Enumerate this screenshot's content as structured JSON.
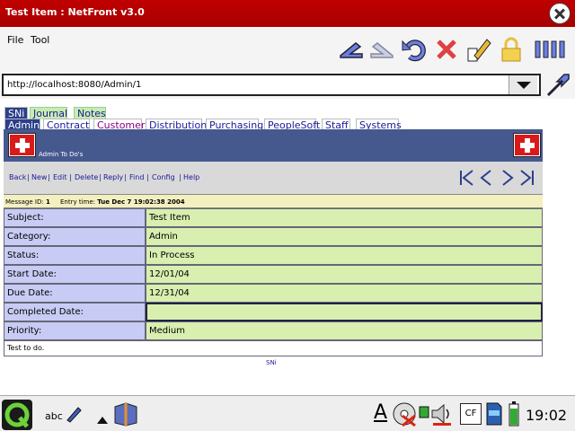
{
  "window": {
    "title": "Test Item : NetFront v3.0"
  },
  "menu": {
    "file": "File",
    "tool": "Tool"
  },
  "toolbar": [
    "back-icon",
    "forward-icon",
    "reload-icon",
    "stop-icon",
    "edit-icon",
    "lock-icon",
    "bars-icon"
  ],
  "url": {
    "value": "http://localhost:8080/Admin/1"
  },
  "tabs_row1": [
    {
      "label": "SNi",
      "style": "active"
    },
    {
      "label": "Journal",
      "style": "green"
    },
    {
      "label": "Notes",
      "style": "green"
    }
  ],
  "tabs_row2": [
    {
      "label": "Admin",
      "style": "active"
    },
    {
      "label": "Contract",
      "style": "normal"
    },
    {
      "label": "Customer",
      "style": "purple"
    },
    {
      "label": "Distribution",
      "style": "normal"
    },
    {
      "label": "Purchasing",
      "style": "normal"
    },
    {
      "label": "PeopleSoft",
      "style": "normal"
    },
    {
      "label": "Staff",
      "style": "normal"
    },
    {
      "label": "Systems",
      "style": "normal"
    }
  ],
  "banner": {
    "label": "Admin To Do's"
  },
  "links": [
    "Back",
    "New",
    "Edit",
    "Delete",
    "Reply",
    "Find",
    "Config",
    "Help"
  ],
  "message": {
    "id_label": "Message ID:",
    "id_value": "1",
    "entry_label": "Entry time:",
    "entry_value": "Tue Dec 7 19:02:38 2004"
  },
  "fields": [
    {
      "label": "Subject:",
      "value": "Test Item"
    },
    {
      "label": "Category:",
      "value": "Admin"
    },
    {
      "label": "Status:",
      "value": "In Process"
    },
    {
      "label": "Start Date:",
      "value": "12/01/04"
    },
    {
      "label": "Due Date:",
      "value": "12/31/04"
    },
    {
      "label": "Completed Date:",
      "value": ""
    },
    {
      "label": "Priority:",
      "value": "Medium"
    }
  ],
  "notes": "Test to do.",
  "footer": "SNi",
  "taskbar": {
    "input_method": "abc",
    "clock": "19:02",
    "font_glyph": "A",
    "cf_label": "CF"
  },
  "colors": {
    "titlebar": "#c00000",
    "banner": "#46598f",
    "label_bg": "#c8ccf4",
    "value_bg": "#d8efb0",
    "link": "#1a1a99"
  }
}
